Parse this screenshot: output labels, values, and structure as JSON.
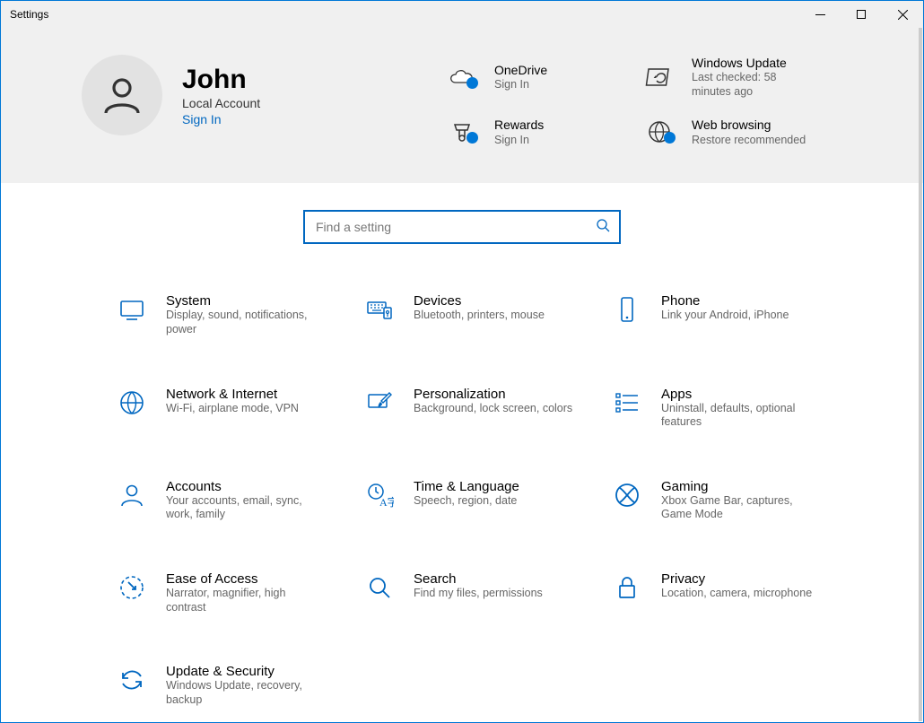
{
  "window": {
    "title": "Settings"
  },
  "user": {
    "name": "John",
    "type": "Local Account",
    "sign_in": "Sign In"
  },
  "tiles": {
    "onedrive": {
      "title": "OneDrive",
      "sub": "Sign In"
    },
    "update": {
      "title": "Windows Update",
      "sub": "Last checked: 58 minutes ago"
    },
    "rewards": {
      "title": "Rewards",
      "sub": "Sign In"
    },
    "web": {
      "title": "Web browsing",
      "sub": "Restore recommended"
    }
  },
  "search": {
    "placeholder": "Find a setting"
  },
  "cats": [
    {
      "id": "system",
      "title": "System",
      "sub": "Display, sound, notifications, power"
    },
    {
      "id": "devices",
      "title": "Devices",
      "sub": "Bluetooth, printers, mouse"
    },
    {
      "id": "phone",
      "title": "Phone",
      "sub": "Link your Android, iPhone"
    },
    {
      "id": "network",
      "title": "Network & Internet",
      "sub": "Wi-Fi, airplane mode, VPN"
    },
    {
      "id": "personalization",
      "title": "Personalization",
      "sub": "Background, lock screen, colors"
    },
    {
      "id": "apps",
      "title": "Apps",
      "sub": "Uninstall, defaults, optional features"
    },
    {
      "id": "accounts",
      "title": "Accounts",
      "sub": "Your accounts, email, sync, work, family"
    },
    {
      "id": "time",
      "title": "Time & Language",
      "sub": "Speech, region, date"
    },
    {
      "id": "gaming",
      "title": "Gaming",
      "sub": "Xbox Game Bar, captures, Game Mode"
    },
    {
      "id": "ease",
      "title": "Ease of Access",
      "sub": "Narrator, magnifier, high contrast"
    },
    {
      "id": "search",
      "title": "Search",
      "sub": "Find my files, permissions"
    },
    {
      "id": "privacy",
      "title": "Privacy",
      "sub": "Location, camera, microphone"
    },
    {
      "id": "updatesec",
      "title": "Update & Security",
      "sub": "Windows Update, recovery, backup"
    }
  ]
}
